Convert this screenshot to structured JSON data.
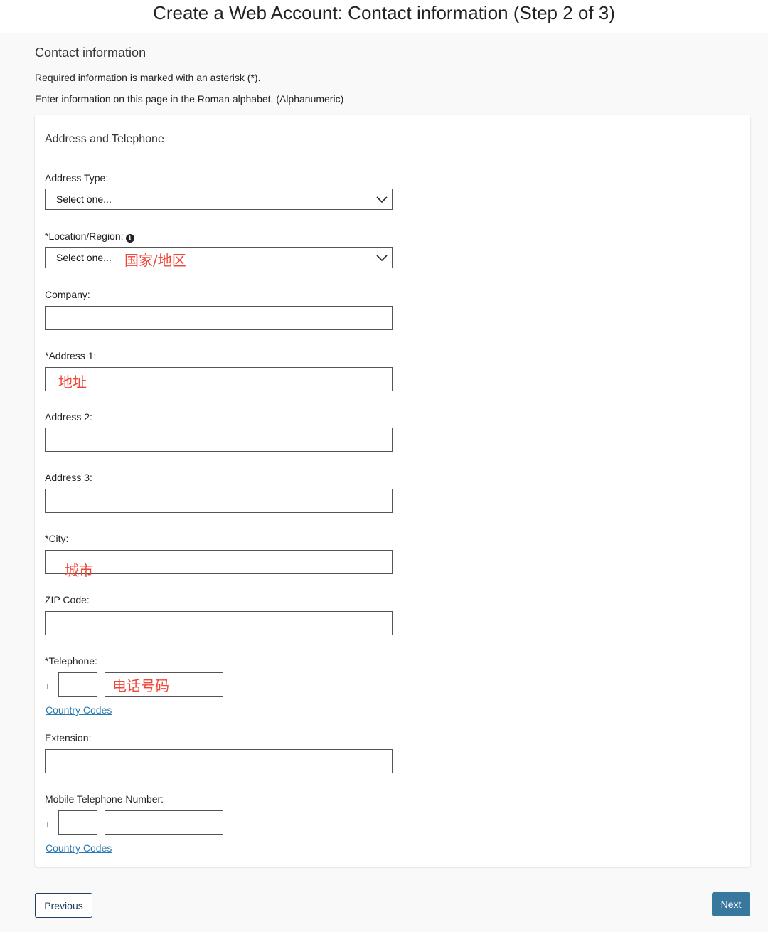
{
  "header": {
    "title": "Create a Web Account: Contact information (Step 2 of 3)"
  },
  "intro": {
    "title": "Contact information",
    "required_note": "Required information is marked with an asterisk (*).",
    "alphabet_note": "Enter information on this page in the Roman alphabet. (Alphanumeric)"
  },
  "card": {
    "title": "Address and Telephone",
    "fields": {
      "address_type": {
        "label": "Address Type:",
        "value": "Select one..."
      },
      "location": {
        "label": "*Location/Region:",
        "value": "Select one...",
        "annotation": "国家/地区",
        "info_icon": "info-icon"
      },
      "company": {
        "label": "Company:",
        "value": ""
      },
      "address1": {
        "label": "*Address 1:",
        "annotation": "地址"
      },
      "address2": {
        "label": "Address 2:",
        "value": ""
      },
      "address3": {
        "label": "Address 3:",
        "value": ""
      },
      "city": {
        "label": "*City:",
        "annotation": "城市"
      },
      "zip": {
        "label": "ZIP Code:",
        "value": ""
      },
      "telephone": {
        "label": "*Telephone:",
        "prefix": "+",
        "annotation": "电话号码",
        "link": "Country Codes"
      },
      "extension": {
        "label": "Extension:",
        "value": ""
      },
      "mobile": {
        "label": "Mobile Telephone Number:",
        "prefix": "+",
        "link": "Country Codes"
      }
    }
  },
  "buttons": {
    "previous": "Previous",
    "next": "Next"
  },
  "colors": {
    "accent": "#38779e",
    "annotation": "#f0473a",
    "link": "#2a7ab0",
    "prev_border": "#1f3f66"
  }
}
